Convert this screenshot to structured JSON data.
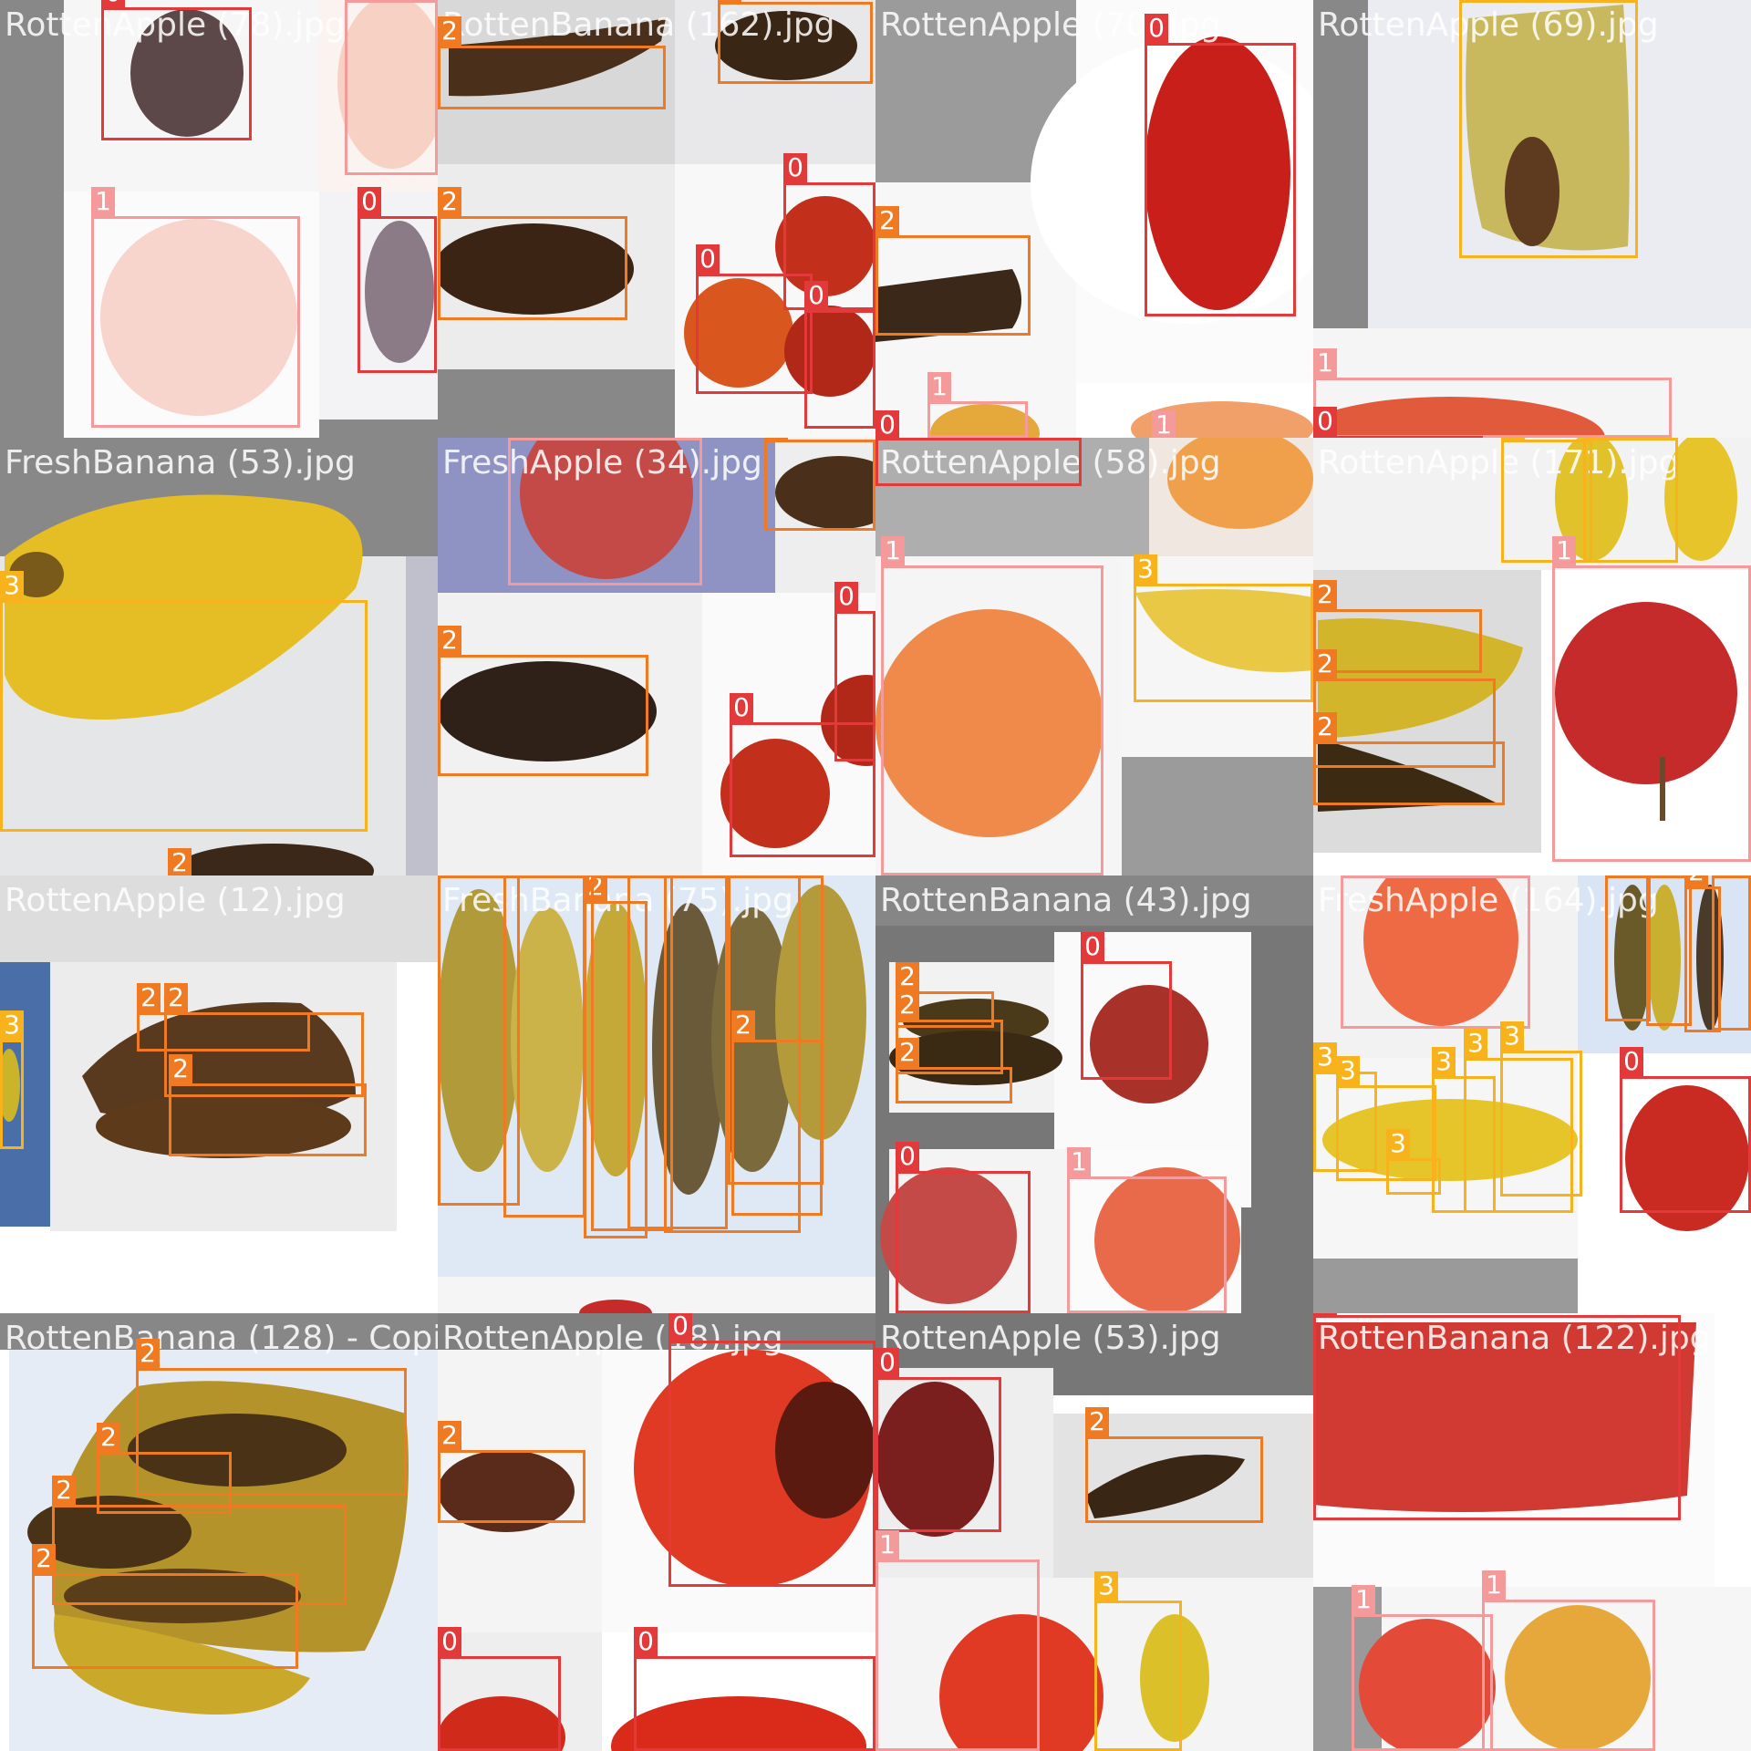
{
  "class_colors": {
    "0": "#e2393a",
    "1": "#f49a9a",
    "2": "#f07a22",
    "3": "#f7b21c"
  },
  "tiles": [
    {
      "title": "RottenApple (78).jpg",
      "boxes": [
        {
          "cls": "0"
        },
        {
          "cls": "1"
        },
        {
          "cls": "1"
        },
        {
          "cls": "0"
        }
      ]
    },
    {
      "title": "RottenBanana (162).jpg",
      "boxes": [
        {
          "cls": "2"
        },
        {
          "cls": "2"
        },
        {
          "cls": "2"
        },
        {
          "cls": "0"
        },
        {
          "cls": "0"
        },
        {
          "cls": "0"
        }
      ]
    },
    {
      "title": "RottenApple (70).jpg",
      "boxes": [
        {
          "cls": "0"
        },
        {
          "cls": "2"
        },
        {
          "cls": "1"
        },
        {
          "cls": "0"
        },
        {
          "cls": "1"
        }
      ]
    },
    {
      "title": "RottenApple (69).jpg",
      "boxes": [
        {
          "cls": "3"
        },
        {
          "cls": "1"
        },
        {
          "cls": "0"
        }
      ]
    },
    {
      "title": "FreshBanana (53).jpg",
      "boxes": [
        {
          "cls": "3"
        },
        {
          "cls": "2"
        }
      ]
    },
    {
      "title": "FreshApple (34).jpg",
      "boxes": [
        {
          "cls": "1"
        },
        {
          "cls": "2"
        },
        {
          "cls": "2"
        },
        {
          "cls": "0"
        },
        {
          "cls": "0"
        }
      ]
    },
    {
      "title": "RottenApple (58).jpg",
      "boxes": [
        {
          "cls": "1"
        },
        {
          "cls": "3"
        },
        {
          "cls": "0"
        }
      ]
    },
    {
      "title": "RottenApple (171).jpg",
      "boxes": [
        {
          "cls": "3"
        },
        {
          "cls": "3"
        },
        {
          "cls": "2"
        },
        {
          "cls": "2"
        },
        {
          "cls": "2"
        },
        {
          "cls": "1"
        }
      ]
    },
    {
      "title": "RottenApple (12).jpg",
      "boxes": [
        {
          "cls": "2"
        },
        {
          "cls": "2"
        },
        {
          "cls": "2"
        },
        {
          "cls": "3"
        }
      ]
    },
    {
      "title": "FreshBanana (75).jpg",
      "boxes": [
        {
          "cls": "2"
        },
        {
          "cls": "2"
        },
        {
          "cls": "2"
        },
        {
          "cls": "2"
        },
        {
          "cls": "2"
        },
        {
          "cls": "2"
        },
        {
          "cls": "2"
        },
        {
          "cls": "2"
        }
      ]
    },
    {
      "title": "RottenBanana (43).jpg",
      "boxes": [
        {
          "cls": "0"
        },
        {
          "cls": "2"
        },
        {
          "cls": "2"
        },
        {
          "cls": "2"
        },
        {
          "cls": "0"
        },
        {
          "cls": "1"
        }
      ]
    },
    {
      "title": "FreshApple (164).jpg",
      "boxes": [
        {
          "cls": "1"
        },
        {
          "cls": "2"
        },
        {
          "cls": "2"
        },
        {
          "cls": "2"
        },
        {
          "cls": "2"
        },
        {
          "cls": "3"
        },
        {
          "cls": "3"
        },
        {
          "cls": "3"
        },
        {
          "cls": "3"
        },
        {
          "cls": "3"
        },
        {
          "cls": "3"
        },
        {
          "cls": "0"
        }
      ]
    },
    {
      "title": "RottenBanana (128) - Copia.jpg",
      "boxes": [
        {
          "cls": "2"
        },
        {
          "cls": "2"
        },
        {
          "cls": "2"
        },
        {
          "cls": "2"
        }
      ]
    },
    {
      "title": "RottenApple (18).jpg",
      "boxes": [
        {
          "cls": "0"
        },
        {
          "cls": "2"
        },
        {
          "cls": "0"
        },
        {
          "cls": "0"
        }
      ]
    },
    {
      "title": "RottenApple (53).jpg",
      "boxes": [
        {
          "cls": "0"
        },
        {
          "cls": "2"
        },
        {
          "cls": "1"
        },
        {
          "cls": "3"
        }
      ]
    },
    {
      "title": "RottenBanana (122).jpg",
      "boxes": [
        {
          "cls": "0"
        },
        {
          "cls": "1"
        },
        {
          "cls": "1"
        }
      ]
    }
  ]
}
